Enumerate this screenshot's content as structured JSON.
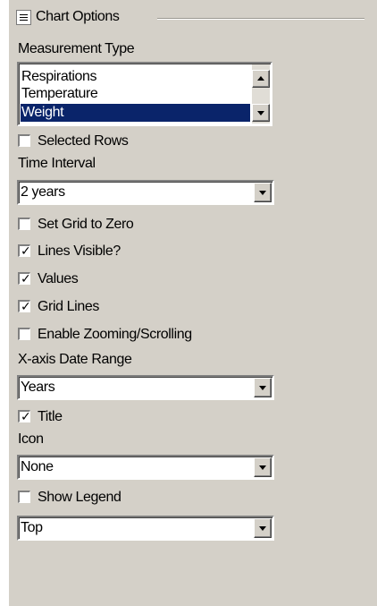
{
  "group": {
    "title": "Chart Options"
  },
  "measurement_type": {
    "label": "Measurement Type",
    "options": [
      "Respirations",
      "Temperature",
      "Weight"
    ],
    "selected": "Weight"
  },
  "checkboxes": {
    "selected_rows": {
      "label": "Selected Rows",
      "checked": false
    },
    "set_grid_zero": {
      "label": "Set Grid to Zero",
      "checked": false
    },
    "lines_visible": {
      "label": "Lines Visible?",
      "checked": true
    },
    "values": {
      "label": "Values",
      "checked": true
    },
    "grid_lines": {
      "label": "Grid Lines",
      "checked": true
    },
    "zooming": {
      "label": "Enable Zooming/Scrolling",
      "checked": false
    },
    "title": {
      "label": "Title",
      "checked": true
    },
    "show_legend": {
      "label": "Show Legend",
      "checked": false
    }
  },
  "time_interval": {
    "label": "Time Interval",
    "value": "2 years"
  },
  "x_axis_range": {
    "label": "X-axis Date Range",
    "value": "Years"
  },
  "icon": {
    "label": "Icon",
    "value": "None"
  },
  "legend_position": {
    "value": "Top"
  },
  "colors": {
    "panel_bg": "#d4d0c8",
    "selection_bg": "#0a246a",
    "selection_fg": "#ffffff"
  },
  "icons": {
    "collapse": "minus-box-icon",
    "scroll_up": "triangle-up-icon",
    "scroll_down": "triangle-down-icon",
    "dropdown": "triangle-down-icon",
    "check": "checkmark-icon"
  }
}
